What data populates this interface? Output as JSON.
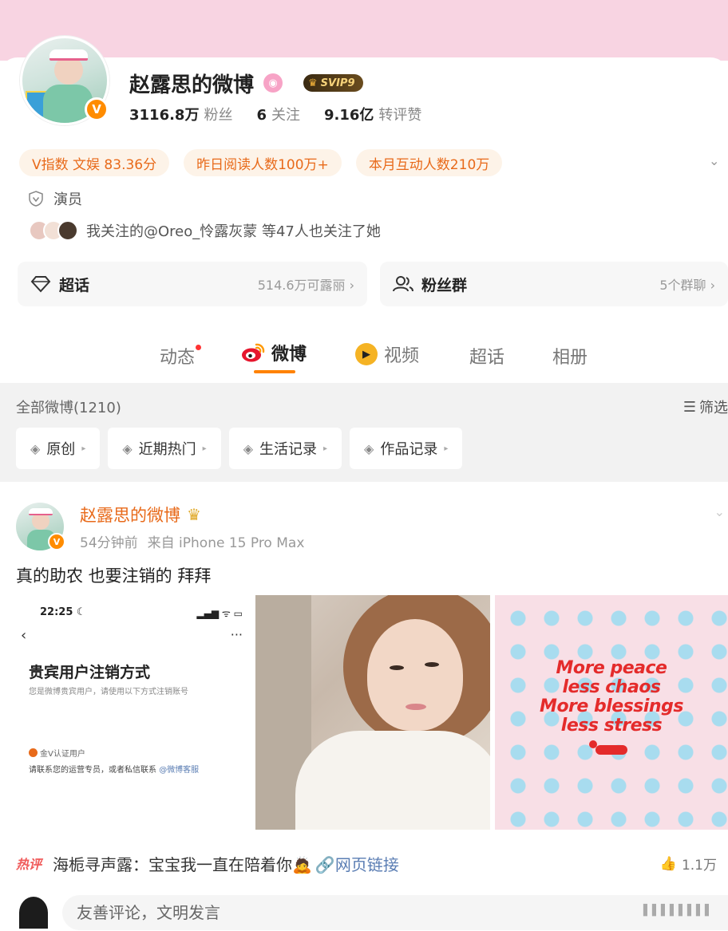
{
  "profile": {
    "name": "赵露思的微博",
    "svip_label": "SVIP9",
    "followers_count": "3116.8万",
    "followers_label": "粉丝",
    "following_count": "6",
    "following_label": "关注",
    "interactions_count": "9.16亿",
    "interactions_label": "转评赞",
    "verified_badge": "V",
    "tags": [
      "V指数 文娱 83.36分",
      "昨日阅读人数100万+",
      "本月互动人数210万"
    ],
    "role": "演员",
    "mutual_text": "我关注的@Oreo_怜露灰蒙 等47人也关注了她",
    "supertopic": {
      "title": "超话",
      "value": "514.6万可露丽"
    },
    "fan_group": {
      "title": "粉丝群",
      "value": "5个群聊"
    }
  },
  "tabs": [
    {
      "label": "动态",
      "has_dot": true
    },
    {
      "label": "微博",
      "active": true
    },
    {
      "label": "视频"
    },
    {
      "label": "超话"
    },
    {
      "label": "相册"
    }
  ],
  "feed": {
    "all_label": "全部微博(1210)",
    "filter_label": "筛选",
    "chips": [
      "原创",
      "近期热门",
      "生活记录",
      "作品记录"
    ]
  },
  "post": {
    "author": "赵露思的微博",
    "time": "54分钟前",
    "source": "来自 iPhone 15 Pro Max",
    "text": "真的助农 也要注销的 拜拜",
    "image1": {
      "clock": "22:25",
      "heading": "贵宾用户注销方式",
      "subtext": "您是微博贵宾用户，请使用以下方式注销账号",
      "gold_v": "金V认证用户",
      "contact": "请联系您的运营专员，或者私信联系",
      "contact_link": "@微博客服"
    },
    "image3_quote": [
      "More peace",
      "less chaos",
      "More blessings",
      "less stress"
    ],
    "hot_comment": {
      "tag": "热评",
      "author": "海栀寻声露",
      "text": "宝宝我一直在陪着你",
      "link": "网页链接",
      "likes": "1.1万"
    },
    "comment_placeholder": "友善评论，文明发言"
  },
  "colors": {
    "accent_orange": "#ff8200",
    "top_band_pink": "#f8d4e2",
    "tag_text": "#e86a1a"
  }
}
